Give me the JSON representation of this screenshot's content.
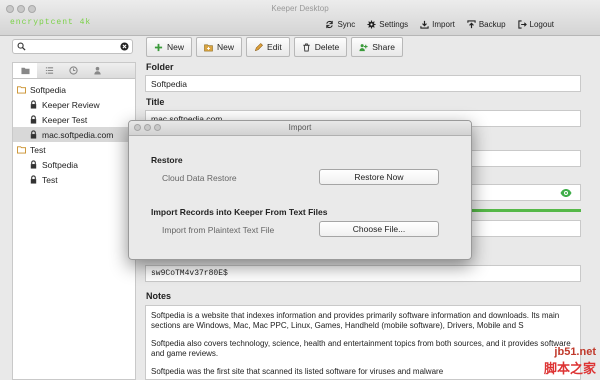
{
  "window": {
    "title": "Keeper Desktop",
    "user_email": "encryptcent 4k"
  },
  "top_actions": [
    {
      "label": "Sync",
      "icon": "sync-icon"
    },
    {
      "label": "Settings",
      "icon": "gear-icon"
    },
    {
      "label": "Import",
      "icon": "import-icon"
    },
    {
      "label": "Backup",
      "icon": "backup-icon"
    },
    {
      "label": "Logout",
      "icon": "logout-icon"
    }
  ],
  "search": {
    "value": "",
    "placeholder": ""
  },
  "toolbar": [
    {
      "label": "New",
      "icon": "plus-icon"
    },
    {
      "label": "New",
      "icon": "folder-add-icon"
    },
    {
      "label": "Edit",
      "icon": "pencil-icon"
    },
    {
      "label": "Delete",
      "icon": "trash-icon"
    },
    {
      "label": "Share",
      "icon": "share-users-icon"
    }
  ],
  "sidebar": {
    "tabs": [
      "folder-tab-icon",
      "list-tab-icon",
      "clock-tab-icon",
      "user-tab-icon"
    ],
    "tree": [
      {
        "type": "folder",
        "label": "Softpedia"
      },
      {
        "type": "record",
        "label": "Keeper Review"
      },
      {
        "type": "record",
        "label": "Keeper Test"
      },
      {
        "type": "record",
        "label": "mac.softpedia.com",
        "selected": true
      },
      {
        "type": "folder",
        "label": "Test"
      },
      {
        "type": "record",
        "label": "Softpedia"
      },
      {
        "type": "record",
        "label": "Test"
      }
    ]
  },
  "detail": {
    "folder_label": "Folder",
    "folder_value": "Softpedia",
    "title_label": "Title",
    "title_value": "mac.softpedia.com",
    "password_value": "sw9CoTM4v37r80E$",
    "notes_label": "Notes",
    "notes": [
      "Softpedia is a website that indexes information and provides primarily software information and downloads. Its main sections are Windows, Mac, Mac PPC, Linux, Games, Handheld (mobile software), Drivers, Mobile and S",
      "Softpedia also covers technology, science, health and entertainment topics from both sources, and it provides software and game reviews.",
      "Softpedia was the first site that scanned its listed software for viruses and malware"
    ]
  },
  "dialog": {
    "title": "Import",
    "restore_heading": "Restore",
    "restore_label": "Cloud Data Restore",
    "restore_button": "Restore Now",
    "import_heading": "Import Records into Keeper From Text Files",
    "import_label": "Import from Plaintext Text File",
    "import_button": "Choose File..."
  },
  "watermark": {
    "site": "jb51.net",
    "cn": "脚本之家"
  },
  "colors": {
    "accent_green": "#55b848",
    "email_green": "#7bd148"
  }
}
